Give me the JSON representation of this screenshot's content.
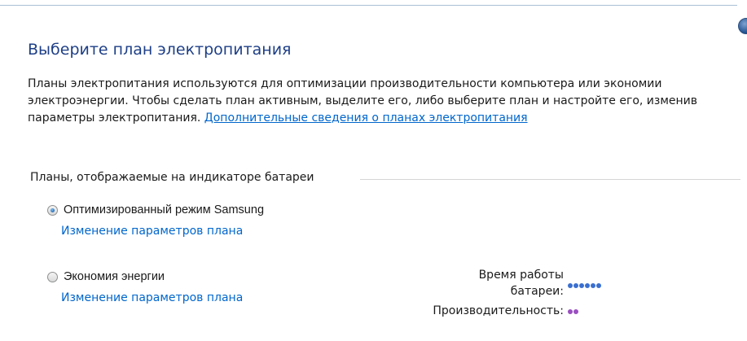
{
  "header": {
    "title": "Выберите план электропитания"
  },
  "intro": {
    "text": "Планы электропитания используются для оптимизации производительности компьютера или экономии электроэнергии. Чтобы сделать план активным, выделите его, либо выберите план и настройте его, изменив параметры электропитания. ",
    "link": "Дополнительные сведения о планах электропитания"
  },
  "plans_group": {
    "label": "Планы, отображаемые на индикаторе батареи",
    "plans": [
      {
        "name": "Оптимизированный режим Samsung",
        "selected": true,
        "change_link": "Изменение параметров плана"
      },
      {
        "name": "Экономия энергии",
        "selected": false,
        "change_link": "Изменение параметров плана",
        "battery_label_line1": "Время работы",
        "battery_label_line2": "батареи:",
        "battery_rating": 6,
        "battery_color": "#3a6fd0",
        "performance_label": "Производительность:",
        "performance_rating": 2,
        "performance_color": "#9a4fc0"
      }
    ]
  }
}
